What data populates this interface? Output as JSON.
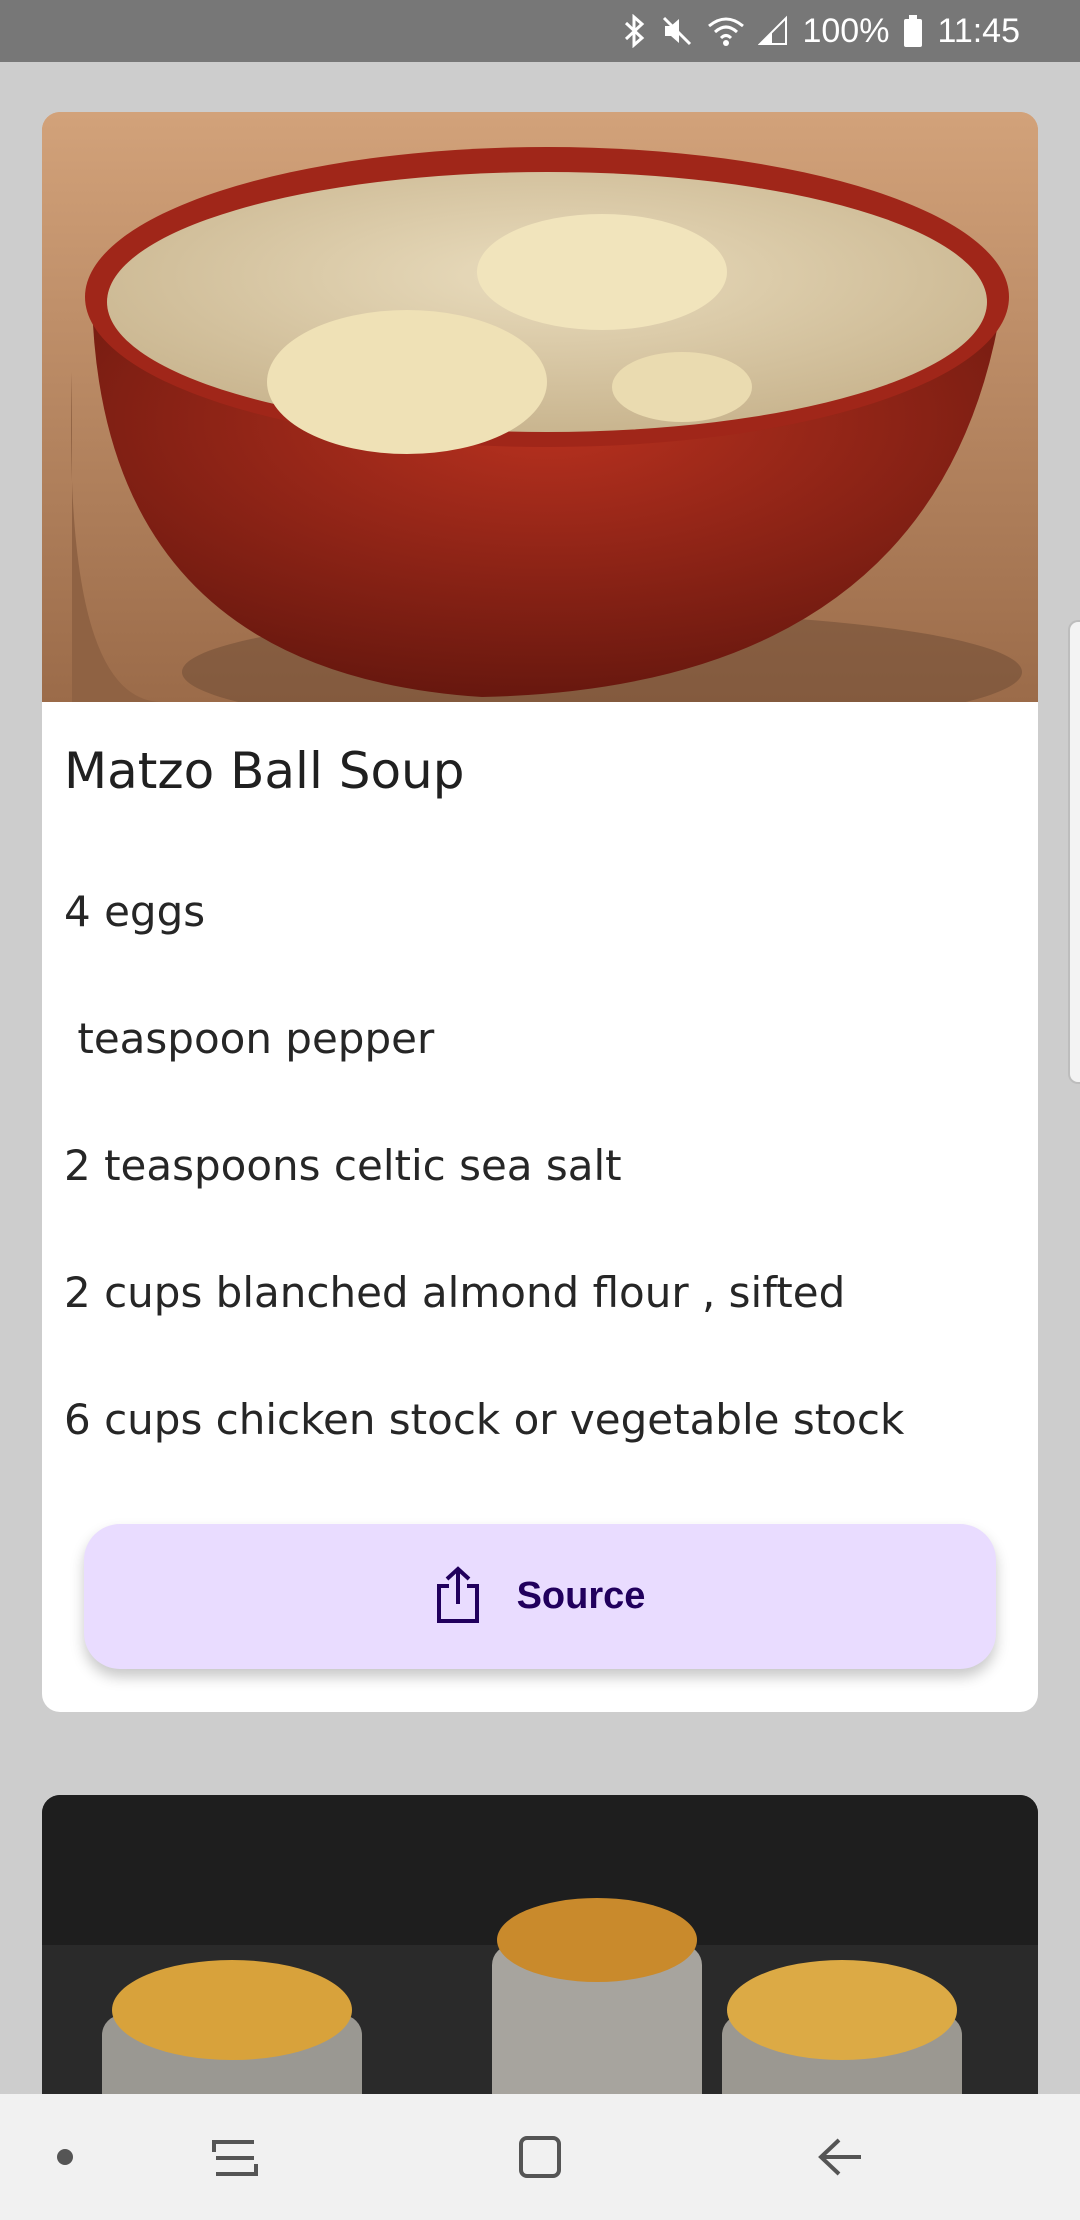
{
  "status_bar": {
    "battery": "100%",
    "time": "11:45",
    "icons": [
      "bluetooth-icon",
      "mute-icon",
      "wifi-icon",
      "signal-icon",
      "battery-icon"
    ]
  },
  "recipe": {
    "title": "Matzo Ball Soup",
    "image_icon": "soup-bowl-photo",
    "ingredients": [
      "4 eggs",
      " teaspoon pepper",
      "2 teaspoons celtic sea salt",
      "2 cups blanched almond flour , sifted",
      "6 cups chicken stock or vegetable stock"
    ],
    "source_button": {
      "label": "Source",
      "icon": "share-icon"
    }
  },
  "next_card": {
    "image_icon": "french-onion-soup-photo"
  },
  "nav_bar": {
    "items": [
      "dot-icon",
      "recent-apps-icon",
      "home-icon",
      "back-icon"
    ]
  },
  "colors": {
    "background": "#cdcdcd",
    "button_bg": "#e9dcff",
    "button_text": "#21005d",
    "status_bar": "#777777"
  }
}
